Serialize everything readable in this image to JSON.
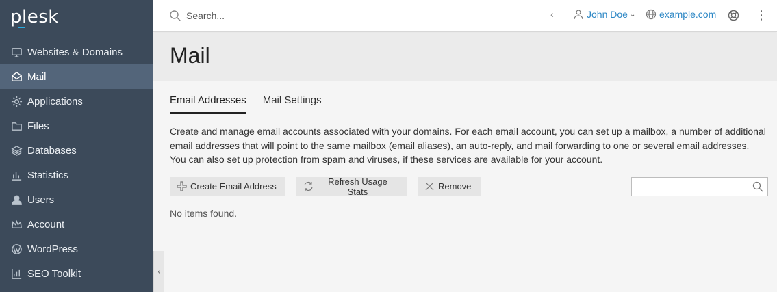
{
  "brand": {
    "name": "plesk",
    "accent": "#28aadf"
  },
  "colors": {
    "sidebar_bg": "#3c4a5a",
    "sidebar_active": "#53657a",
    "link": "#2c87c5"
  },
  "sidebar": {
    "items": [
      {
        "label": "Websites & Domains",
        "icon": "monitor-icon"
      },
      {
        "label": "Mail",
        "icon": "mail-icon",
        "active": true
      },
      {
        "label": "Applications",
        "icon": "gear-icon"
      },
      {
        "label": "Files",
        "icon": "folder-icon"
      },
      {
        "label": "Databases",
        "icon": "layers-icon"
      },
      {
        "label": "Statistics",
        "icon": "bar-chart-icon"
      },
      {
        "label": "Users",
        "icon": "user-icon"
      },
      {
        "label": "Account",
        "icon": "crown-icon"
      },
      {
        "label": "WordPress",
        "icon": "wordpress-icon"
      },
      {
        "label": "SEO Toolkit",
        "icon": "seo-chart-icon"
      }
    ]
  },
  "topbar": {
    "search_placeholder": "Search...",
    "user_name": "John Doe",
    "domain": "example.com"
  },
  "page": {
    "title": "Mail",
    "tabs": [
      {
        "label": "Email Addresses",
        "active": true
      },
      {
        "label": "Mail Settings",
        "active": false
      }
    ],
    "description": "Create and manage email accounts associated with your domains. For each email account, you can set up a mailbox, a number of additional email addresses that will point to the same mailbox (email aliases), an auto-reply, and mail forwarding to one or several email addresses. You can also set up protection from spam and viruses, if these services are available for your account.",
    "buttons": {
      "create": "Create Email Address",
      "refresh": "Refresh Usage Stats",
      "remove": "Remove"
    },
    "empty_text": "No items found."
  }
}
